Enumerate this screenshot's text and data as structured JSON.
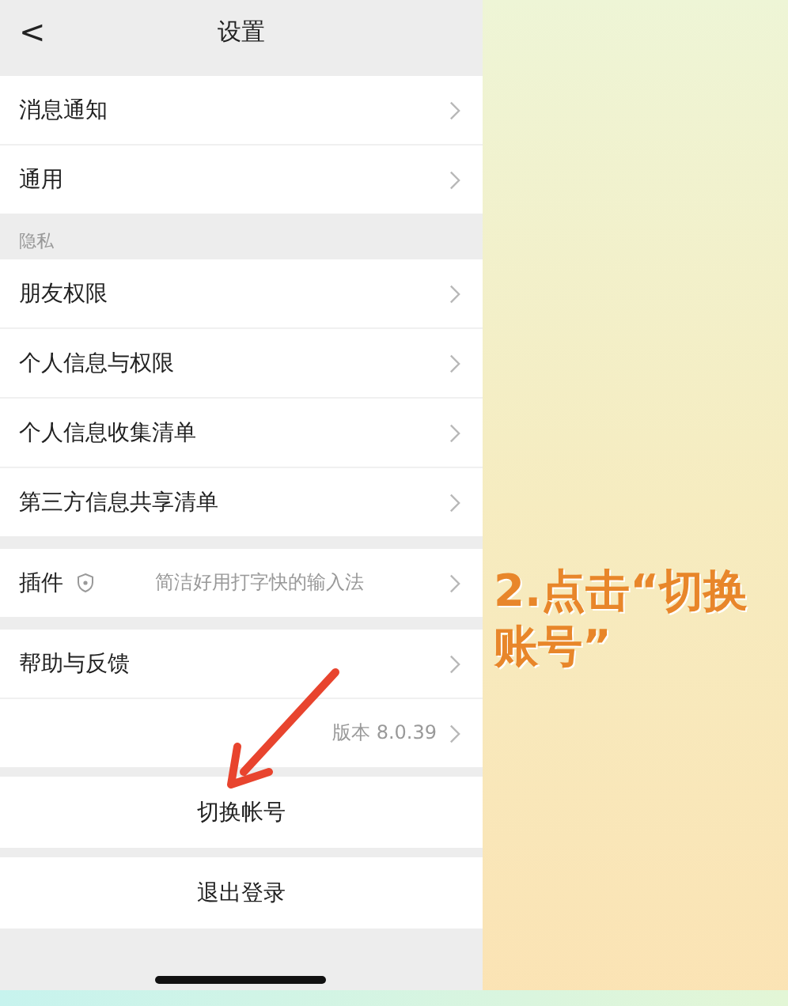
{
  "header": {
    "back": "<",
    "title": "设置"
  },
  "sections": [
    {
      "items": [
        {
          "kind": "nav",
          "label": "消息通知"
        },
        {
          "kind": "nav",
          "label": "通用"
        }
      ]
    },
    {
      "heading": "隐私",
      "items": [
        {
          "kind": "nav",
          "label": "朋友权限"
        },
        {
          "kind": "nav",
          "label": "个人信息与权限"
        },
        {
          "kind": "nav",
          "label": "个人信息收集清单"
        },
        {
          "kind": "nav",
          "label": "第三方信息共享清单"
        }
      ]
    },
    {
      "items": [
        {
          "kind": "plugin",
          "label": "插件",
          "detail": "简洁好用打字快的输入法"
        }
      ]
    },
    {
      "items": [
        {
          "kind": "nav",
          "label": "帮助与反馈"
        },
        {
          "kind": "version",
          "detail": "版本 8.0.39"
        }
      ]
    }
  ],
  "actions": [
    "切换帐号",
    "退出登录"
  ],
  "annotation": "2.点击“切换账号”"
}
